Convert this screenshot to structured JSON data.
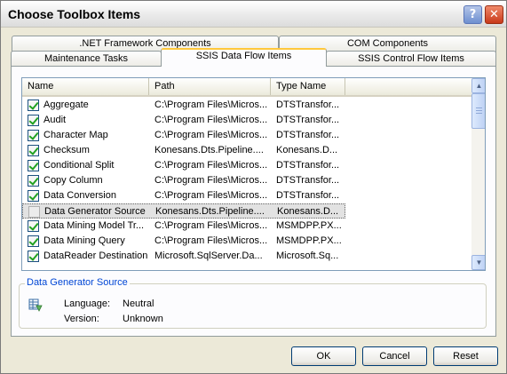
{
  "window": {
    "title": "Choose Toolbox Items"
  },
  "title_buttons": {
    "help": "?",
    "close": "✕"
  },
  "tabs": {
    "row1": [
      ".NET Framework Components",
      "COM Components"
    ],
    "row2": [
      "Maintenance Tasks",
      "SSIS Data Flow Items",
      "SSIS Control Flow Items"
    ],
    "active": "SSIS Data Flow Items"
  },
  "list": {
    "columns": [
      "Name",
      "Path",
      "Type Name"
    ],
    "rows": [
      {
        "checked": true,
        "name": "Aggregate",
        "path": "C:\\Program Files\\Micros...",
        "type": "DTSTransfor..."
      },
      {
        "checked": true,
        "name": "Audit",
        "path": "C:\\Program Files\\Micros...",
        "type": "DTSTransfor..."
      },
      {
        "checked": true,
        "name": "Character Map",
        "path": "C:\\Program Files\\Micros...",
        "type": "DTSTransfor..."
      },
      {
        "checked": true,
        "name": "Checksum",
        "path": "Konesans.Dts.Pipeline....",
        "type": "Konesans.D..."
      },
      {
        "checked": true,
        "name": "Conditional Split",
        "path": "C:\\Program Files\\Micros...",
        "type": "DTSTransfor..."
      },
      {
        "checked": true,
        "name": "Copy Column",
        "path": "C:\\Program Files\\Micros...",
        "type": "DTSTransfor..."
      },
      {
        "checked": true,
        "name": "Data Conversion",
        "path": "C:\\Program Files\\Micros...",
        "type": "DTSTransfor..."
      },
      {
        "checked": false,
        "name": "Data Generator Source",
        "path": "Konesans.Dts.Pipeline....",
        "type": "Konesans.D...",
        "selected": true
      },
      {
        "checked": true,
        "name": "Data Mining Model Tr...",
        "path": "C:\\Program Files\\Micros...",
        "type": "MSMDPP.PX..."
      },
      {
        "checked": true,
        "name": "Data Mining Query",
        "path": "C:\\Program Files\\Micros...",
        "type": "MSMDPP.PX..."
      },
      {
        "checked": true,
        "name": "DataReader Destination",
        "path": "Microsoft.SqlServer.Da...",
        "type": "Microsoft.Sq..."
      }
    ]
  },
  "details": {
    "title": "Data Generator Source",
    "language_label": "Language:",
    "language_value": "Neutral",
    "version_label": "Version:",
    "version_value": "Unknown"
  },
  "buttons": {
    "ok": "OK",
    "cancel": "Cancel",
    "reset": "Reset"
  },
  "colors": {
    "accent_tab": "#ffc83c",
    "group_title": "#0046d5",
    "check": "#21a121"
  }
}
